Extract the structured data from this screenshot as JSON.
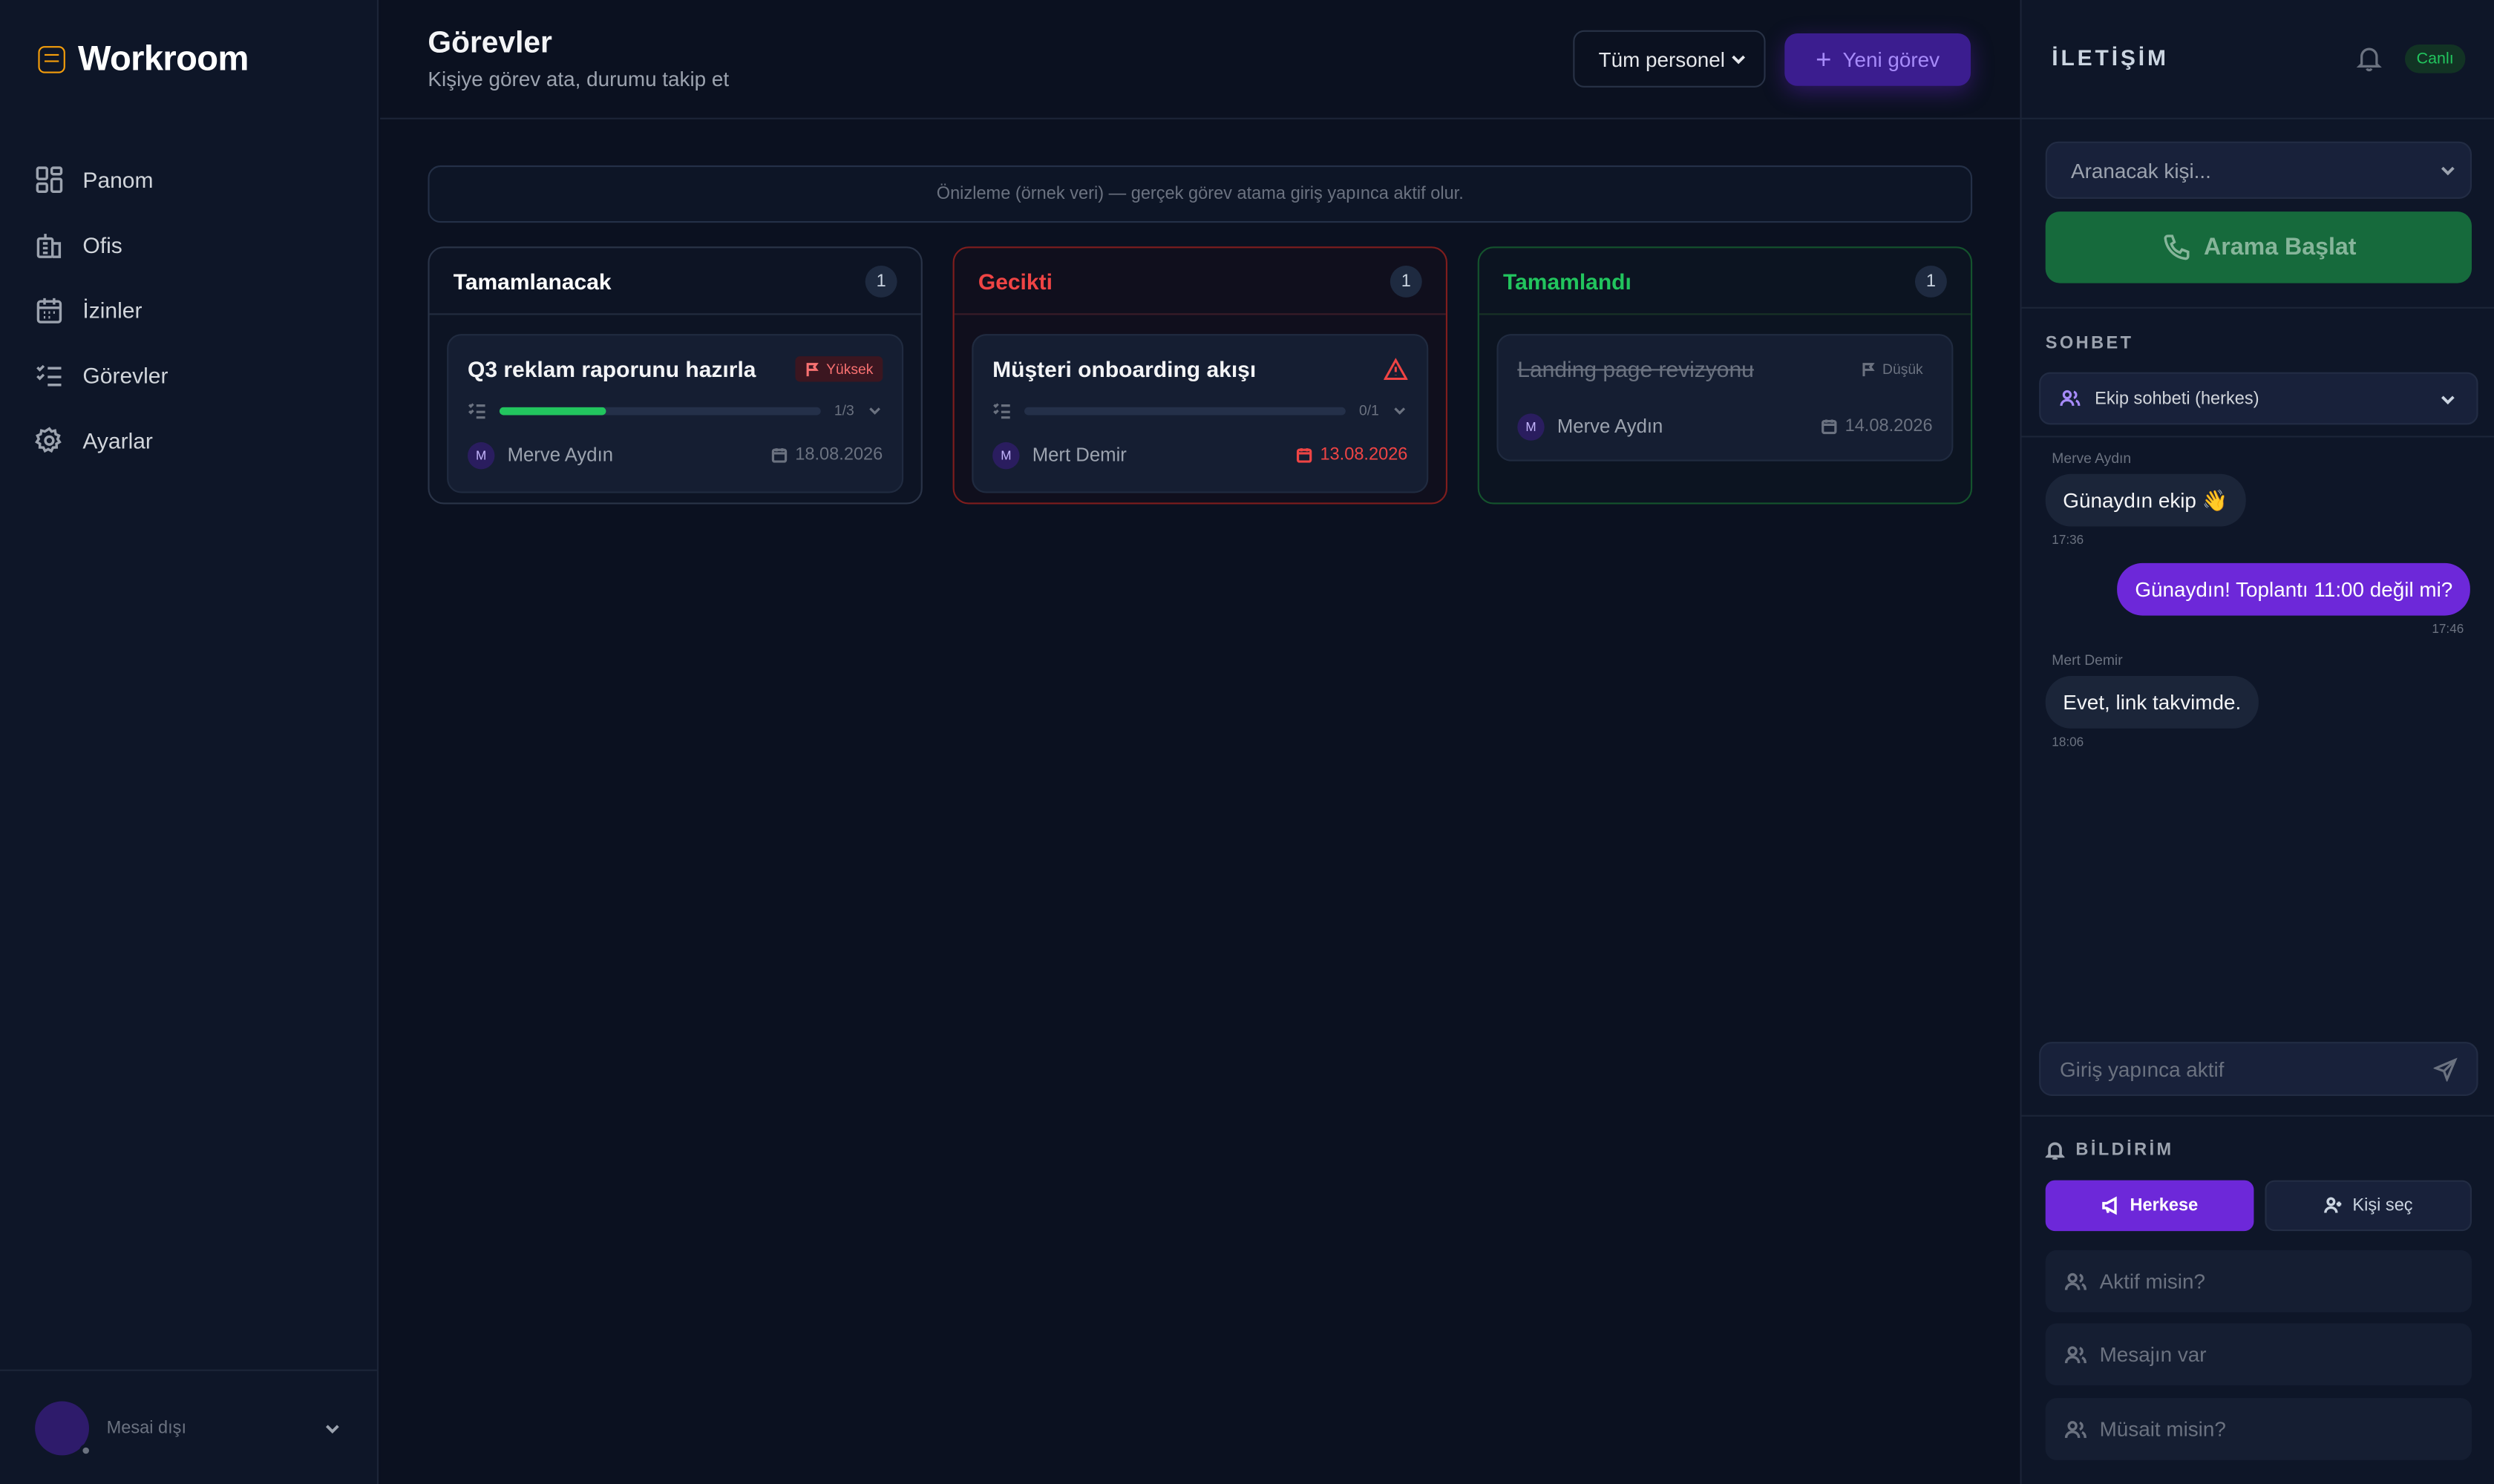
{
  "app": {
    "name": "Workroom"
  },
  "sidebar": {
    "items": [
      {
        "label": "Panom",
        "icon": "dashboard-icon"
      },
      {
        "label": "Ofis",
        "icon": "building-icon"
      },
      {
        "label": "İzinler",
        "icon": "calendar-icon"
      },
      {
        "label": "Görevler",
        "icon": "tasks-icon"
      },
      {
        "label": "Ayarlar",
        "icon": "gear-icon"
      }
    ],
    "status_label": "Mesai dışı"
  },
  "header": {
    "title": "Görevler",
    "subtitle": "Kişiye görev ata, durumu takip et",
    "staff_filter": "Tüm personel",
    "new_task_label": "Yeni görev"
  },
  "preview_notice": "Önizleme (örnek veri) — gerçek görev atama giriş yapınca aktif olur.",
  "columns": [
    {
      "title": "Tamamlanacak",
      "count": "1",
      "accent": "#ffffff",
      "card": {
        "title": "Q3 reklam raporunu hazırla",
        "priority": "Yüksek",
        "subtasks": "1/3",
        "progress": 0.33,
        "assignee_initial": "M",
        "assignee": "Merve Aydın",
        "due": "18.08.2026"
      }
    },
    {
      "title": "Gecikti",
      "count": "1",
      "accent": "#ef4444",
      "card": {
        "title": "Müşteri onboarding akışı",
        "subtasks": "0/1",
        "progress": 0,
        "assignee_initial": "M",
        "assignee": "Mert Demir",
        "due": "13.08.2026"
      }
    },
    {
      "title": "Tamamlandı",
      "count": "1",
      "accent": "#22c55e",
      "card": {
        "title": "Landing page revizyonu",
        "priority": "Düşük",
        "assignee_initial": "M",
        "assignee": "Merve Aydın",
        "due": "14.08.2026"
      }
    }
  ],
  "panel": {
    "title": "İLETİŞİM",
    "live_badge": "Canlı",
    "call_select_placeholder": "Aranacak kişi...",
    "call_button": "Arama Başlat",
    "chat_section": "SOHBET",
    "chat_channel": "Ekip sohbeti (herkes)",
    "messages": [
      {
        "author": "Merve Aydın",
        "text": "Günaydın ekip 👋",
        "time": "17:36",
        "direction": "in"
      },
      {
        "author": "",
        "text": "Günaydın! Toplantı 11:00 değil mi?",
        "time": "17:46",
        "direction": "out"
      },
      {
        "author": "Mert Demir",
        "text": "Evet, link takvimde.",
        "time": "18:06",
        "direction": "in"
      }
    ],
    "chat_input_placeholder": "Giriş yapınca aktif",
    "notify_section": "BİLDİRİM",
    "notify_all": "Herkese",
    "notify_pick": "Kişi seç",
    "quick_messages": [
      "Aktif misin?",
      "Mesajın var",
      "Müsait misin?"
    ]
  }
}
